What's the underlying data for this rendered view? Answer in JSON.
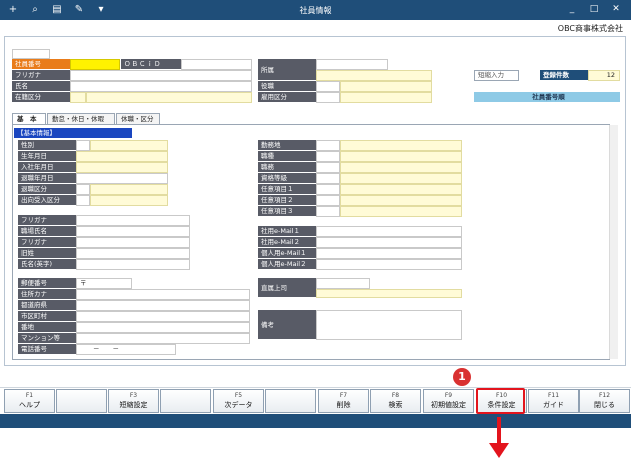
{
  "window": {
    "title": "社員情報",
    "company": "OBC商事株式会社",
    "toolbar_icons": [
      "add-user-icon",
      "zoom-icon",
      "print-icon",
      "tool-icon",
      "dropdown-icon"
    ],
    "controls": [
      "minimize-icon",
      "maximize-icon",
      "close-icon"
    ],
    "control_glyphs": [
      "_",
      "□",
      "✕"
    ]
  },
  "header": {
    "employee_no_label": "社員番号",
    "employee_no_value": "",
    "obc_id_label": "ＯＢＣｉＤ",
    "furigana_label": "フリガナ",
    "name_label": "氏名",
    "status_label": "在籍区分",
    "dept_label": "所属",
    "position_label": "役職",
    "employment_label": "雇用区分",
    "short_input_label": "短縮入力",
    "registered_label": "登録件数",
    "registered_value": "12",
    "sort_label": "社員番号順"
  },
  "tabs": [
    "基　本",
    "勤怠・休日・休暇",
    "休職・区分"
  ],
  "section_title": "【基本情報】",
  "left_fields": [
    "性別",
    "生年月日",
    "入社年月日",
    "退職年月日",
    "退職区分",
    "出向受入区分"
  ],
  "right_fields": [
    "勤務地",
    "職種",
    "職務",
    "資格等級",
    "任意項目１",
    "任意項目２",
    "任意項目３"
  ],
  "left_fields2": [
    "フリガナ",
    "職場氏名",
    "フリガナ",
    "旧姓",
    "氏名(英字)"
  ],
  "right_fields2": [
    "社用e-Mail１",
    "社用e-Mail２",
    "個人用e-Mail１",
    "個人用e-Mail２"
  ],
  "address_fields": [
    "郵便番号",
    "住所カナ",
    "都道府県",
    "市区町村",
    "番地",
    "マンション等",
    "電話番号"
  ],
  "postal_mark": "〒",
  "phone_value": "－　　－",
  "boss_label": "直属上司",
  "note_label": "備考",
  "fkeys": [
    {
      "key": "F1",
      "name": "ヘルプ"
    },
    {
      "key": "",
      "name": ""
    },
    {
      "key": "F3",
      "name": "短縮設定"
    },
    {
      "key": "",
      "name": ""
    },
    {
      "key": "F5",
      "name": "次データ"
    },
    {
      "key": "",
      "name": ""
    },
    {
      "key": "F7",
      "name": "削除"
    },
    {
      "key": "F8",
      "name": "検索"
    },
    {
      "key": "F9",
      "name": "初期値設定"
    },
    {
      "key": "F10",
      "name": "条件設定"
    },
    {
      "key": "F11",
      "name": "ガイド"
    },
    {
      "key": "F12",
      "name": "閉じる"
    }
  ],
  "callout": {
    "number": "1",
    "color": "#e3141d"
  }
}
